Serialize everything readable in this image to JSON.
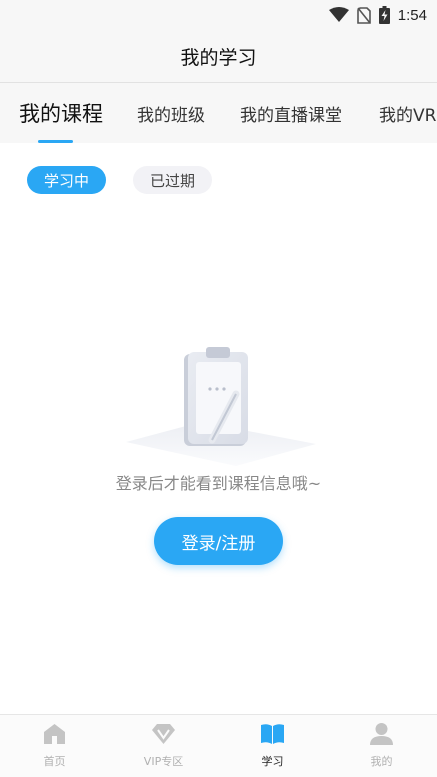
{
  "status_bar": {
    "time": "1:54",
    "icons": [
      "wifi-icon",
      "no-sim-icon",
      "battery-charging-icon"
    ]
  },
  "header": {
    "title": "我的学习"
  },
  "tabs": [
    {
      "label": "我的课程",
      "active": true
    },
    {
      "label": "我的班级",
      "active": false
    },
    {
      "label": "我的直播课堂",
      "active": false
    },
    {
      "label": "我的VR",
      "active": false
    }
  ],
  "filters": [
    {
      "label": "学习中",
      "active": true
    },
    {
      "label": "已过期",
      "active": false
    }
  ],
  "empty_state": {
    "message": "登录后才能看到课程信息哦~",
    "illustration": "clipboard-pen-illustration"
  },
  "login_button": {
    "label": "登录/注册"
  },
  "bottom_nav": [
    {
      "label": "首页",
      "icon": "home-icon",
      "active": false
    },
    {
      "label": "VIP专区",
      "icon": "diamond-icon",
      "active": false
    },
    {
      "label": "学习",
      "icon": "book-icon",
      "active": true
    },
    {
      "label": "我的",
      "icon": "person-icon",
      "active": false
    }
  ],
  "colors": {
    "accent": "#2aa7f4",
    "inactive": "#b0b0b0",
    "background": "#f7f7f7"
  }
}
